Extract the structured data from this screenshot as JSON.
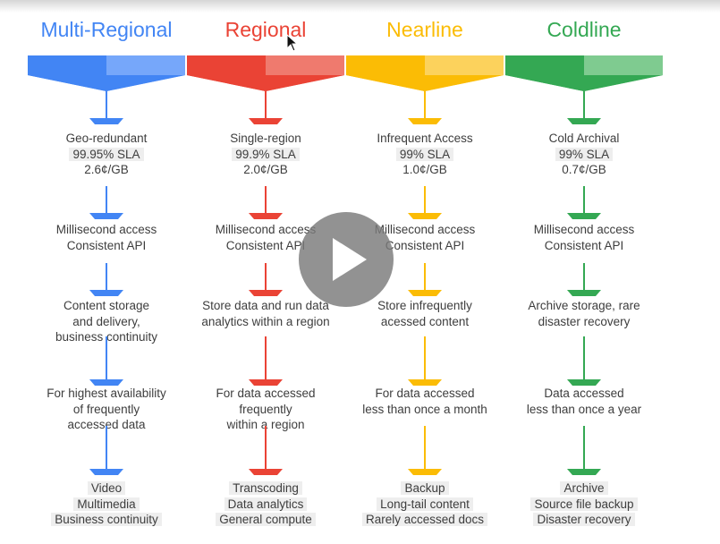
{
  "columns": [
    {
      "title": "Multi-Regional",
      "color": "#4285f4",
      "light": "#76a7fa",
      "blocks": [
        [
          "Geo-redundant",
          "99.95% SLA",
          "2.6¢/GB"
        ],
        [
          "Millisecond access",
          "Consistent API"
        ],
        [
          "Content storage",
          "and delivery,",
          "business continuity"
        ],
        [
          "For highest availability",
          "of frequently",
          "accessed data"
        ],
        [
          "Video",
          "Multimedia",
          "Business continuity"
        ]
      ]
    },
    {
      "title": "Regional",
      "color": "#ea4335",
      "light": "#ef7a6e",
      "blocks": [
        [
          "Single-region",
          "99.9% SLA",
          "2.0¢/GB"
        ],
        [
          "Millisecond access",
          "Consistent API"
        ],
        [
          "Store data and run data",
          "analytics within a region"
        ],
        [
          "For data accessed",
          "frequently",
          "within a region"
        ],
        [
          "Transcoding",
          "Data analytics",
          "General compute"
        ]
      ]
    },
    {
      "title": "Nearline",
      "color": "#fbbc05",
      "light": "#fcd25c",
      "blocks": [
        [
          "Infrequent Access",
          "99% SLA",
          "1.0¢/GB"
        ],
        [
          "Millisecond access",
          "Consistent API"
        ],
        [
          "Store infrequently",
          "acessed content"
        ],
        [
          "For data accessed",
          "less than once a month"
        ],
        [
          "Backup",
          "Long-tail content",
          "Rarely accessed docs"
        ]
      ]
    },
    {
      "title": "Coldline",
      "color": "#34a853",
      "light": "#7fcb90",
      "blocks": [
        [
          "Cold Archival",
          "99% SLA",
          "0.7¢/GB"
        ],
        [
          "Millisecond access",
          "Consistent API"
        ],
        [
          "Archive storage, rare",
          "disaster recovery"
        ],
        [
          "Data accessed",
          "less than once a year"
        ],
        [
          "Archive",
          "Source file backup",
          "Disaster recovery"
        ]
      ]
    }
  ]
}
